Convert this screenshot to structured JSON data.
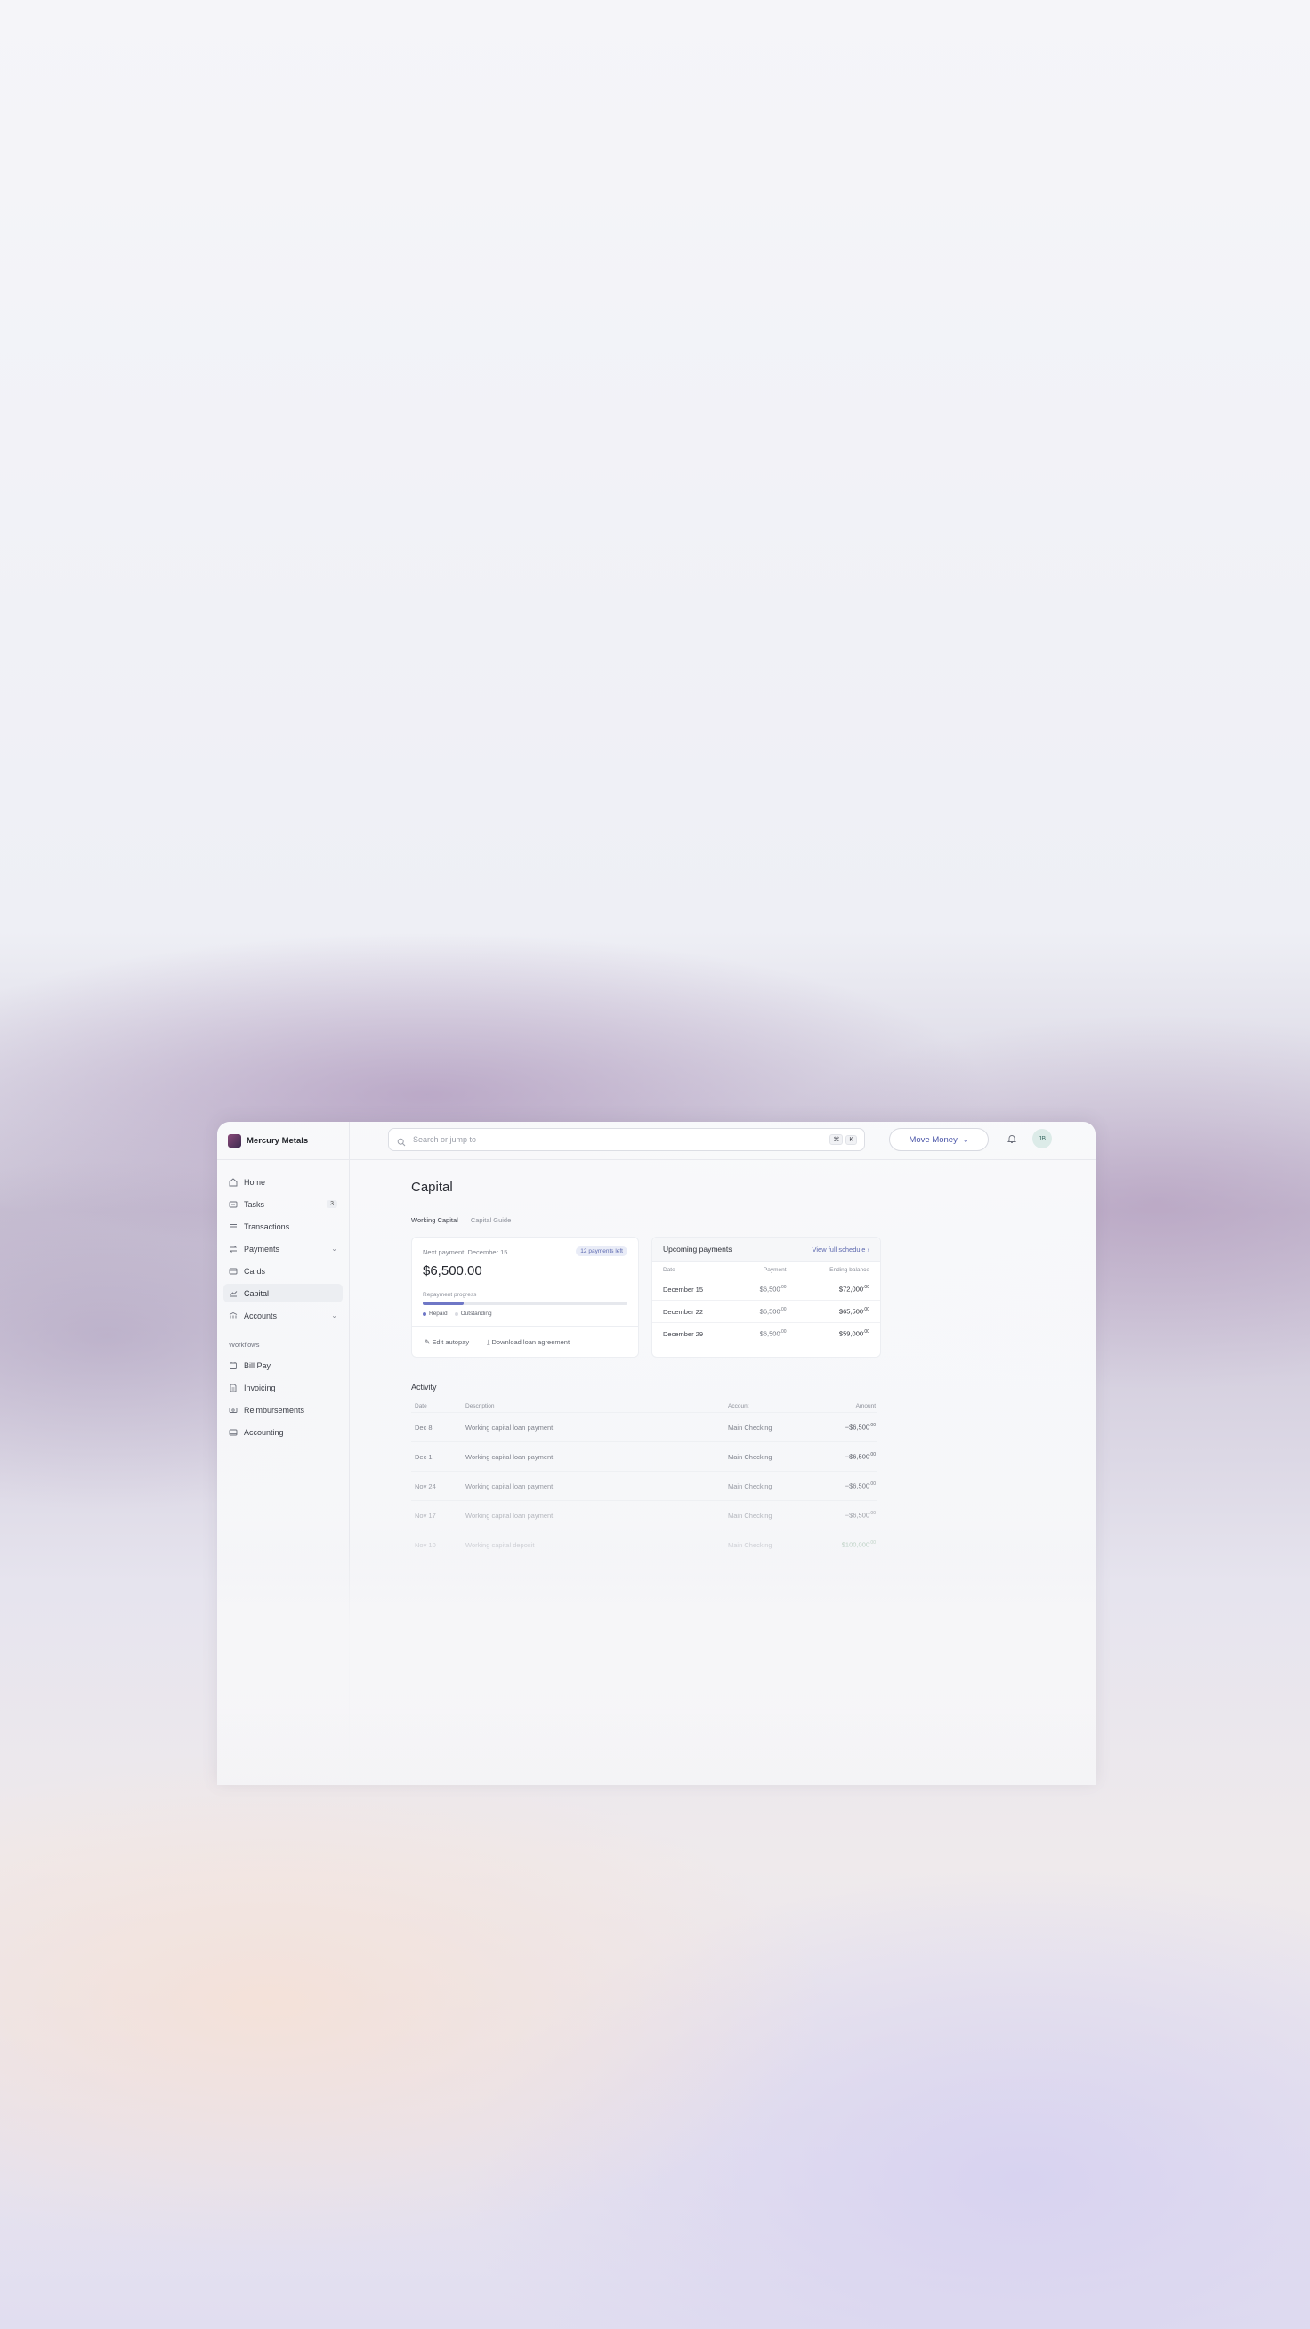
{
  "org": {
    "name": "Mercury Metals"
  },
  "sidebar": {
    "items": [
      {
        "label": "Home",
        "icon": "home-icon"
      },
      {
        "label": "Tasks",
        "icon": "tasks-icon",
        "badge": "3"
      },
      {
        "label": "Transactions",
        "icon": "transactions-icon"
      },
      {
        "label": "Payments",
        "icon": "payments-icon"
      },
      {
        "label": "Cards",
        "icon": "card-icon"
      },
      {
        "label": "Capital",
        "icon": "capital-icon",
        "active": true
      },
      {
        "label": "Accounts",
        "icon": "accounts-icon"
      }
    ],
    "workflows_label": "Workflows",
    "workflows": [
      {
        "label": "Bill Pay",
        "icon": "bill-pay-icon"
      },
      {
        "label": "Invoicing",
        "icon": "invoice-icon"
      },
      {
        "label": "Reimbursements",
        "icon": "reimbursements-icon"
      },
      {
        "label": "Accounting",
        "icon": "accounting-icon"
      }
    ]
  },
  "search": {
    "placeholder": "Search or jump to",
    "shortcut_1": "⌘",
    "shortcut_2": "K"
  },
  "topbar": {
    "move_money": "Move Money",
    "avatar_initials": "JB"
  },
  "page": {
    "title": "Capital"
  },
  "tabs": [
    "Working Capital",
    "Capital Guide"
  ],
  "next_payment": {
    "label": "Next payment: December 15",
    "payments_left": "12 payments left",
    "amount": "$6,500.00",
    "progress_label": "Repayment progress",
    "progress": 0.2,
    "legend_repaid": "Repaid",
    "legend_outstanding": "Outstanding",
    "edit_autopay": "Edit autopay",
    "download": "Download loan agreement"
  },
  "upcoming": {
    "title": "Upcoming payments",
    "link": "View full schedule",
    "headers": [
      "Date",
      "Payment",
      "Ending balance"
    ],
    "rows": [
      {
        "date": "December 15",
        "payment": "$6,500",
        "payment_cents": ".00",
        "balance": "$72,000",
        "balance_cents": ".00"
      },
      {
        "date": "December 22",
        "payment": "$6,500",
        "payment_cents": ".00",
        "balance": "$65,500",
        "balance_cents": ".00"
      },
      {
        "date": "December 29",
        "payment": "$6,500",
        "payment_cents": ".00",
        "balance": "$59,000",
        "balance_cents": ".00"
      }
    ]
  },
  "activity": {
    "title": "Activity",
    "headers": [
      "Date",
      "Description",
      "Account",
      "Amount"
    ],
    "rows": [
      {
        "date": "Dec 8",
        "description": "Working capital loan payment",
        "account": "Main Checking",
        "amount": "−$6,500",
        "cents": ".00"
      },
      {
        "date": "Dec 1",
        "description": "Working capital loan payment",
        "account": "Main Checking",
        "amount": "−$6,500",
        "cents": ".00"
      },
      {
        "date": "Nov 24",
        "description": "Working capital loan payment",
        "account": "Main Checking",
        "amount": "−$6,500",
        "cents": ".00"
      },
      {
        "date": "Nov 17",
        "description": "Working capital loan payment",
        "account": "Main Checking",
        "amount": "−$6,500",
        "cents": ".00"
      },
      {
        "date": "Nov 10",
        "description": "Working capital deposit",
        "account": "Main Checking",
        "amount": "$100,000",
        "cents": ".00"
      }
    ]
  },
  "colors": {
    "accent": "#4b56a8",
    "progress_fill": "#6f77c6",
    "progress_track": "#e6e8ed"
  }
}
